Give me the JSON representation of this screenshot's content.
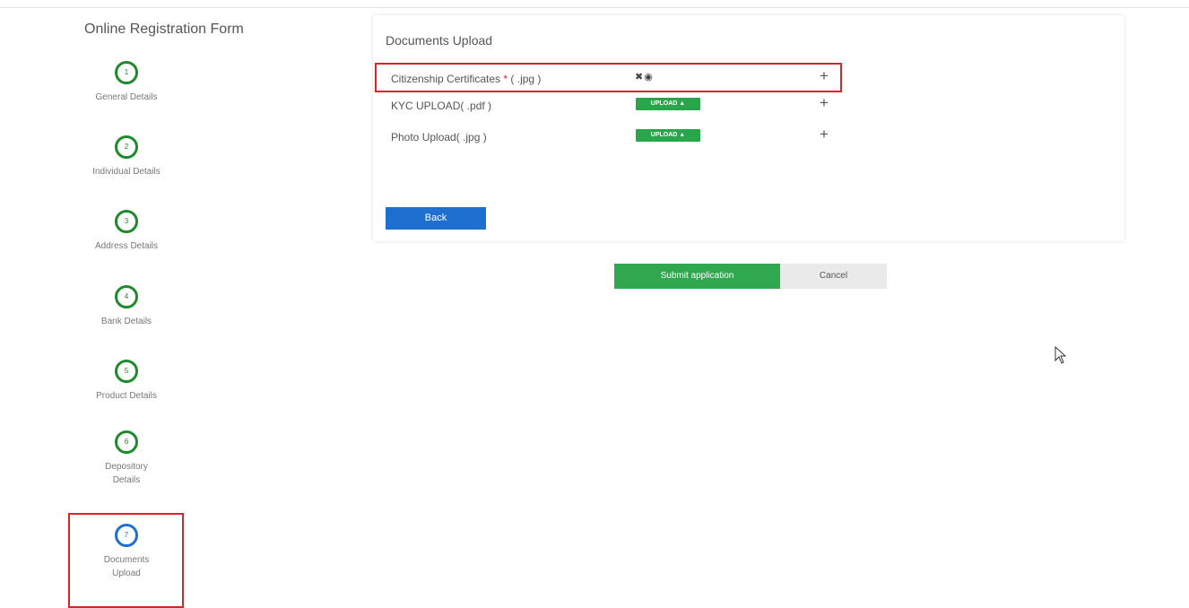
{
  "sidebar": {
    "title": "Online Registration Form",
    "steps": [
      {
        "number": "1",
        "label": "General Details",
        "state": "complete"
      },
      {
        "number": "2",
        "label": "Individual Details",
        "state": "complete"
      },
      {
        "number": "3",
        "label": "Address Details",
        "state": "complete"
      },
      {
        "number": "4",
        "label": "Bank Details",
        "state": "complete"
      },
      {
        "number": "5",
        "label": "Product Details",
        "state": "complete"
      },
      {
        "number": "6",
        "label_line1": "Depository",
        "label_line2": "Details",
        "state": "complete"
      },
      {
        "number": "7",
        "label_line1": "Documents",
        "label_line2": "Upload",
        "state": "active"
      }
    ]
  },
  "panel": {
    "title": "Documents Upload",
    "documents": [
      {
        "label": "Citizenship Certificates",
        "required_marker": "*",
        "format": "( .jpg )",
        "status": "uploaded",
        "actions": "✖👁",
        "add": "+"
      },
      {
        "label": "KYC UPLOAD( .pdf )",
        "upload_label": "UPLOAD",
        "add": "+"
      },
      {
        "label": "Photo Upload( .jpg )",
        "upload_label": "UPLOAD",
        "add": "+"
      }
    ],
    "back_label": "Back"
  },
  "actions": {
    "submit_label": "Submit application",
    "cancel_label": "Cancel"
  },
  "colors": {
    "step_complete": "#1e8a2c",
    "step_active": "#1f6fd1",
    "upload_button": "#29a64a",
    "submit_button": "#2fa84f",
    "back_button": "#1f6fd1",
    "highlight": "#d6252c"
  },
  "icons": {
    "upload": "user-upload-icon",
    "remove": "close-icon",
    "view": "eye-icon",
    "add": "plus-icon"
  }
}
